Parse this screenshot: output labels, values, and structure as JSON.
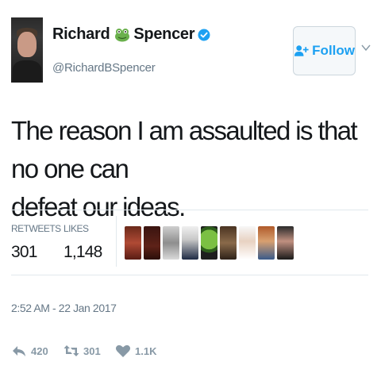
{
  "author": {
    "first_name": "Richard",
    "last_name": "Spencer",
    "handle": "@RichardBSpencer",
    "name_icon": "frog-emoji-icon",
    "badge_icon": "verified-badge-icon"
  },
  "follow_button": {
    "label": "Follow",
    "icon": "add-user-icon"
  },
  "tweet": {
    "line1": "The reason I am assaulted is that no one can",
    "line2": "defeat our ideas."
  },
  "stats": {
    "retweets_label": "RETWEETS",
    "retweets_value": "301",
    "likes_label": "LIKES",
    "likes_value": "1,148"
  },
  "liker_avatars": 9,
  "timestamp": "2:52 AM - 22 Jan 2017",
  "actions": {
    "reply_count": "420",
    "retweet_count": "301",
    "like_count": "1.1K"
  },
  "colors": {
    "accent": "#1da1f2",
    "muted": "#657786",
    "icon_gray": "#8899a6",
    "divider": "#e1e8ed"
  }
}
